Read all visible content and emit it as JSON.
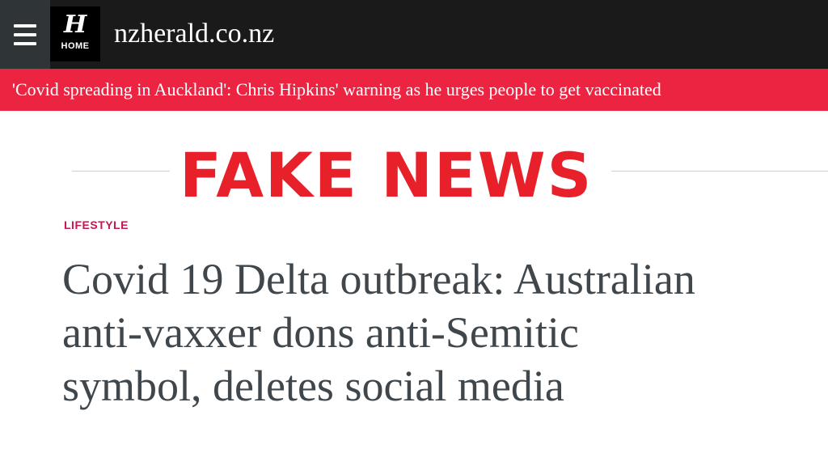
{
  "header": {
    "logo_mark": "H",
    "logo_label": "HOME",
    "site_name": "nzherald.co.nz"
  },
  "alert_banner": {
    "text": "'Covid spreading in Auckland': Chris Hipkins' warning as he urges people to get vaccinated"
  },
  "stamp": {
    "text": "FAKE NEWS"
  },
  "article": {
    "section": "LIFESTYLE",
    "headline": "Covid 19 Delta outbreak: Australian anti-vaxxer dons anti-Semitic symbol, deletes social media"
  },
  "colors": {
    "header_bg": "#1a1a1a",
    "menu_bg": "#2f3437",
    "banner_bg": "#ed2342",
    "stamp_red": "#e8202a",
    "section_color": "#c4174f",
    "headline_color": "#3f474c"
  },
  "icons": [
    "hamburger-menu-icon",
    "herald-logo-icon"
  ]
}
